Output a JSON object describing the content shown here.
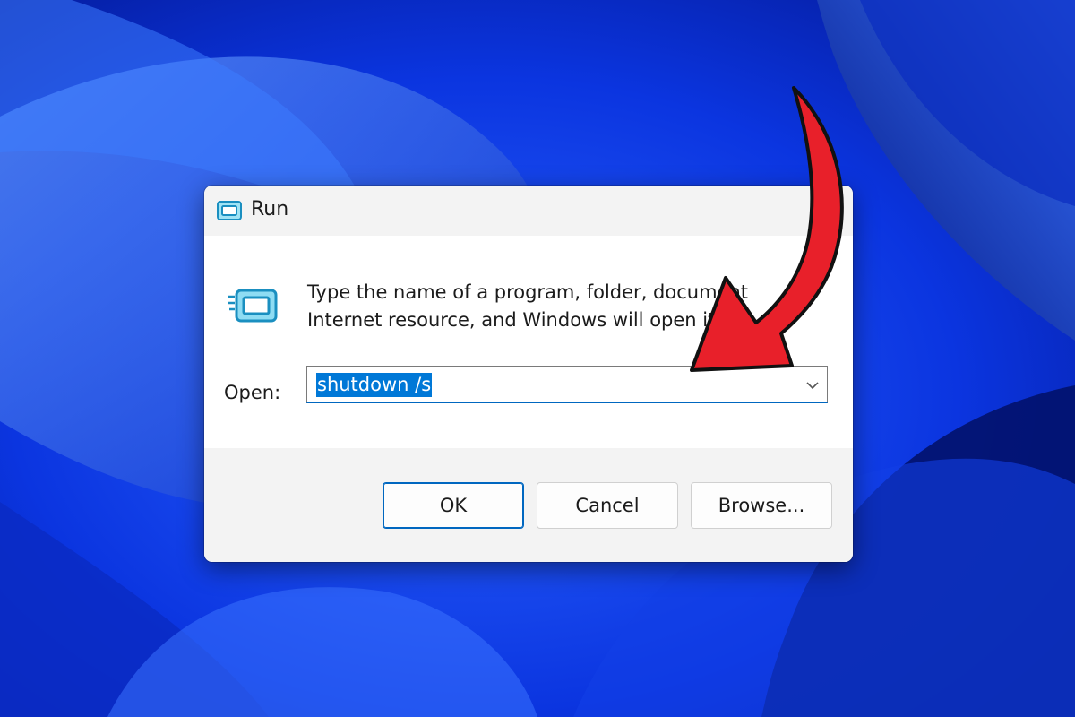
{
  "window": {
    "title": "Run",
    "icon": "run-icon"
  },
  "dialog": {
    "description_line1": "Type the name of a program, folder, document",
    "description_line2": "Internet resource, and Windows will open it",
    "open_label": "Open:",
    "command_value": "shutdown /s",
    "dropdown_icon": "chevron-down-icon"
  },
  "buttons": {
    "ok_label": "OK",
    "cancel_label": "Cancel",
    "browse_label": "Browse..."
  },
  "annotation": {
    "arrow_color": "#e8202a",
    "arrow_icon": "curved-arrow-icon"
  },
  "colors": {
    "accent": "#0067c0",
    "selection": "#0078d7",
    "wallpaper": "#0a2fd9"
  }
}
